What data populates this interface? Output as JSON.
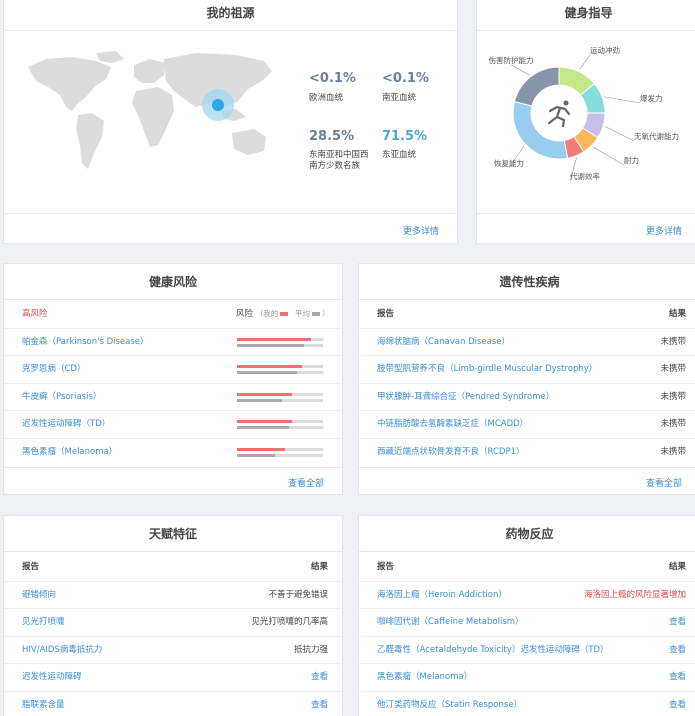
{
  "ancestry": {
    "title": "我的祖源",
    "stats": [
      {
        "pct": "<0.1%",
        "label": "欧洲血统",
        "color": "gray"
      },
      {
        "pct": "<0.1%",
        "label": "南亚血统",
        "color": "gray"
      },
      {
        "pct": "28.5%",
        "label": "东南亚和中国西南方少数名族",
        "color": "gray"
      },
      {
        "pct": "71.5%",
        "label": "东亚血统",
        "color": "blue"
      }
    ],
    "more": "更多详情"
  },
  "fitness": {
    "title": "健身指导",
    "donut": [
      {
        "label": "运动冲劲",
        "value": 14,
        "color": "#c6e68a"
      },
      {
        "label": "爆发力",
        "value": 11,
        "color": "#88dcd8"
      },
      {
        "label": "无氧代谢能力",
        "value": 9,
        "color": "#c7bfe8"
      },
      {
        "label": "耐力",
        "value": 7,
        "color": "#f7b75a"
      },
      {
        "label": "代谢效率",
        "value": 6,
        "color": "#f27a78"
      },
      {
        "label": "恢复能力",
        "value": 32,
        "color": "#98cdf0"
      },
      {
        "label": "伤害防护能力",
        "value": 21,
        "color": "#8796a8"
      }
    ],
    "more": "更多详情"
  },
  "health_risk": {
    "title": "健康风险",
    "high_risk_label": "高风险",
    "risk_label": "风险",
    "legend_mine": "我的",
    "legend_avg": "平均",
    "rows": [
      {
        "name": "帕金森（Parkinson's Disease）",
        "mine": 0.86,
        "avg": 0.78
      },
      {
        "name": "克罗恩病（CD）",
        "mine": 0.76,
        "avg": 0.7
      },
      {
        "name": "牛皮癣（Psoriasis）",
        "mine": 0.64,
        "avg": 0.52
      },
      {
        "name": "迟发性运动障碍（TD）",
        "mine": 0.64,
        "avg": 0.6
      },
      {
        "name": "黑色素瘤（Melanoma）",
        "mine": 0.56,
        "avg": 0.44
      }
    ],
    "more": "查看全部"
  },
  "genetic": {
    "title": "遗传性疾病",
    "col_report": "报告",
    "col_result": "结果",
    "rows": [
      {
        "name": "海绵状脑病（Canavan Disease）",
        "result": "未携带"
      },
      {
        "name": "肢带型肌营养不良（Limb-girdle Muscular Dystrophy）",
        "result": "未携带"
      },
      {
        "name": "甲状腺肿-耳聋综合征（Pendred Syndrome）",
        "result": "未携带"
      },
      {
        "name": "中链脂肪酸去氢酶素缺乏症（MCADD）",
        "result": "未携带"
      },
      {
        "name": "西藏近端点状软骨发育不良（RCDP1）",
        "result": "未携带"
      }
    ],
    "more": "查看全部"
  },
  "traits": {
    "title": "天赋特征",
    "col_report": "报告",
    "col_result": "结果",
    "rows": [
      {
        "name": "避错倾向",
        "result": "不善于避免错误",
        "style": "plain"
      },
      {
        "name": "见光打喷嚏",
        "result": "见光打喷嚏的几率高",
        "style": "plain"
      },
      {
        "name": "HIV/AIDS病毒抵抗力",
        "result": "抵抗力强",
        "style": "plain"
      },
      {
        "name": "迟发性运动障碍",
        "result": "查看",
        "style": "link"
      },
      {
        "name": "脂联素含量",
        "result": "查看",
        "style": "link"
      }
    ]
  },
  "drugs": {
    "title": "药物反应",
    "col_report": "报告",
    "col_result": "结果",
    "rows": [
      {
        "name": "海洛因上瘾（Heroin Addiction）",
        "result": "海洛因上瘾的风险显著增加",
        "style": "red"
      },
      {
        "name": "咖啡因代谢（Caffeine Metabolism）",
        "result": "查看",
        "style": "link"
      },
      {
        "name": "乙醛毒性（Acetaldehyde Toxicity）迟发性运动障碍（TD）",
        "result": "查看",
        "style": "link"
      },
      {
        "name": "黑色素瘤（Melanoma）",
        "result": "查看",
        "style": "link"
      },
      {
        "name": "他汀类药物反应（Statin Response）",
        "result": "查看",
        "style": "link"
      }
    ]
  }
}
